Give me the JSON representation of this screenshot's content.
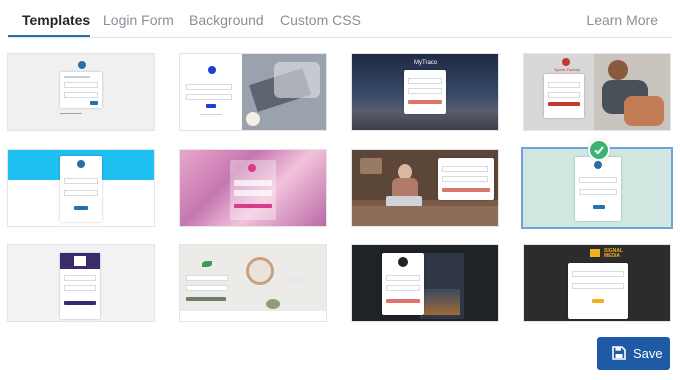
{
  "tabs": [
    {
      "label": "Templates",
      "active": true
    },
    {
      "label": "Login Form"
    },
    {
      "label": "Background"
    },
    {
      "label": "Custom CSS"
    }
  ],
  "learn_more": "Learn More",
  "save_label": "Save",
  "accent_color": "#2271b1",
  "save_color": "#1e5aa6",
  "selected_template": 8,
  "templates": [
    {
      "label": "",
      "brand": ""
    },
    {
      "label": "",
      "brand": ""
    },
    {
      "label": "",
      "brand": "MyTraco"
    },
    {
      "label": "",
      "brand": "Sports Factory"
    },
    {
      "label": "",
      "brand": ""
    },
    {
      "label": "",
      "brand": ""
    },
    {
      "label": "",
      "brand": ""
    },
    {
      "label": "",
      "brand": ""
    },
    {
      "label": "",
      "brand": ""
    },
    {
      "label": "",
      "brand": ""
    },
    {
      "label": "",
      "brand": ""
    },
    {
      "label": "",
      "brand": "SIGNAL MEDIA"
    }
  ]
}
